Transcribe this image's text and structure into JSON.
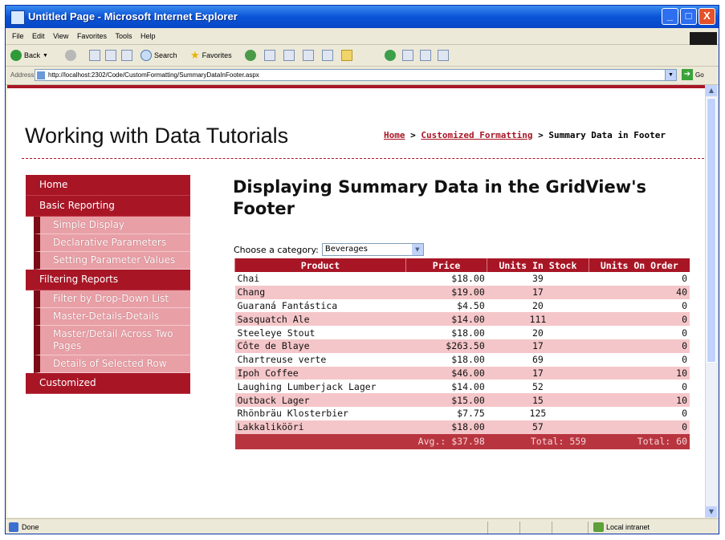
{
  "window": {
    "title": "Untitled Page - Microsoft Internet Explorer",
    "min_label": "_",
    "max_label": "□",
    "close_label": "X"
  },
  "menu": [
    "File",
    "Edit",
    "View",
    "Favorites",
    "Tools",
    "Help"
  ],
  "toolbar": {
    "back": "Back",
    "search": "Search",
    "favorites": "Favorites"
  },
  "address": {
    "label": "Address",
    "url": "http://localhost:2302/Code/CustomFormatting/SummaryDataInFooter.aspx",
    "go": "Go"
  },
  "site": {
    "title": "Working with Data Tutorials"
  },
  "breadcrumb": {
    "home": "Home",
    "sep": " > ",
    "section": "Customized Formatting",
    "current": "Summary Data in Footer"
  },
  "sidebar": {
    "items": [
      {
        "label": "Home",
        "level": 0
      },
      {
        "label": "Basic Reporting",
        "level": 0
      },
      {
        "label": "Simple Display",
        "level": 1
      },
      {
        "label": "Declarative Parameters",
        "level": 1
      },
      {
        "label": "Setting Parameter Values",
        "level": 1
      },
      {
        "label": "Filtering Reports",
        "level": 0
      },
      {
        "label": "Filter by Drop-Down List",
        "level": 1
      },
      {
        "label": "Master-Details-Details",
        "level": 1
      },
      {
        "label": "Master/Detail Across Two Pages",
        "level": 1
      },
      {
        "label": "Details of Selected Row",
        "level": 1
      },
      {
        "label": "Customized",
        "level": 0
      }
    ]
  },
  "main": {
    "heading": "Displaying Summary Data in the GridView's Footer",
    "choose_label": "Choose a category:",
    "category_selected": "Beverages"
  },
  "grid": {
    "headers": [
      "Product",
      "Price",
      "Units In Stock",
      "Units On Order"
    ],
    "rows": [
      [
        "Chai",
        "$18.00",
        "39",
        "0"
      ],
      [
        "Chang",
        "$19.00",
        "17",
        "40"
      ],
      [
        "Guaraná Fantástica",
        "$4.50",
        "20",
        "0"
      ],
      [
        "Sasquatch Ale",
        "$14.00",
        "111",
        "0"
      ],
      [
        "Steeleye Stout",
        "$18.00",
        "20",
        "0"
      ],
      [
        "Côte de Blaye",
        "$263.50",
        "17",
        "0"
      ],
      [
        "Chartreuse verte",
        "$18.00",
        "69",
        "0"
      ],
      [
        "Ipoh Coffee",
        "$46.00",
        "17",
        "10"
      ],
      [
        "Laughing Lumberjack Lager",
        "$14.00",
        "52",
        "0"
      ],
      [
        "Outback Lager",
        "$15.00",
        "15",
        "10"
      ],
      [
        "Rhönbräu Klosterbier",
        "$7.75",
        "125",
        "0"
      ],
      [
        "Lakkalikööri",
        "$18.00",
        "57",
        "0"
      ]
    ],
    "footer": [
      "",
      "Avg.: $37.98",
      "Total: 559",
      "Total: 60"
    ]
  },
  "status": {
    "left": "Done",
    "zone": "Local intranet"
  },
  "colors": {
    "accent": "#a81626",
    "alt_row": "#f5c6c9",
    "footer_row": "#b8353f",
    "submenu": "#e8a0a6"
  }
}
